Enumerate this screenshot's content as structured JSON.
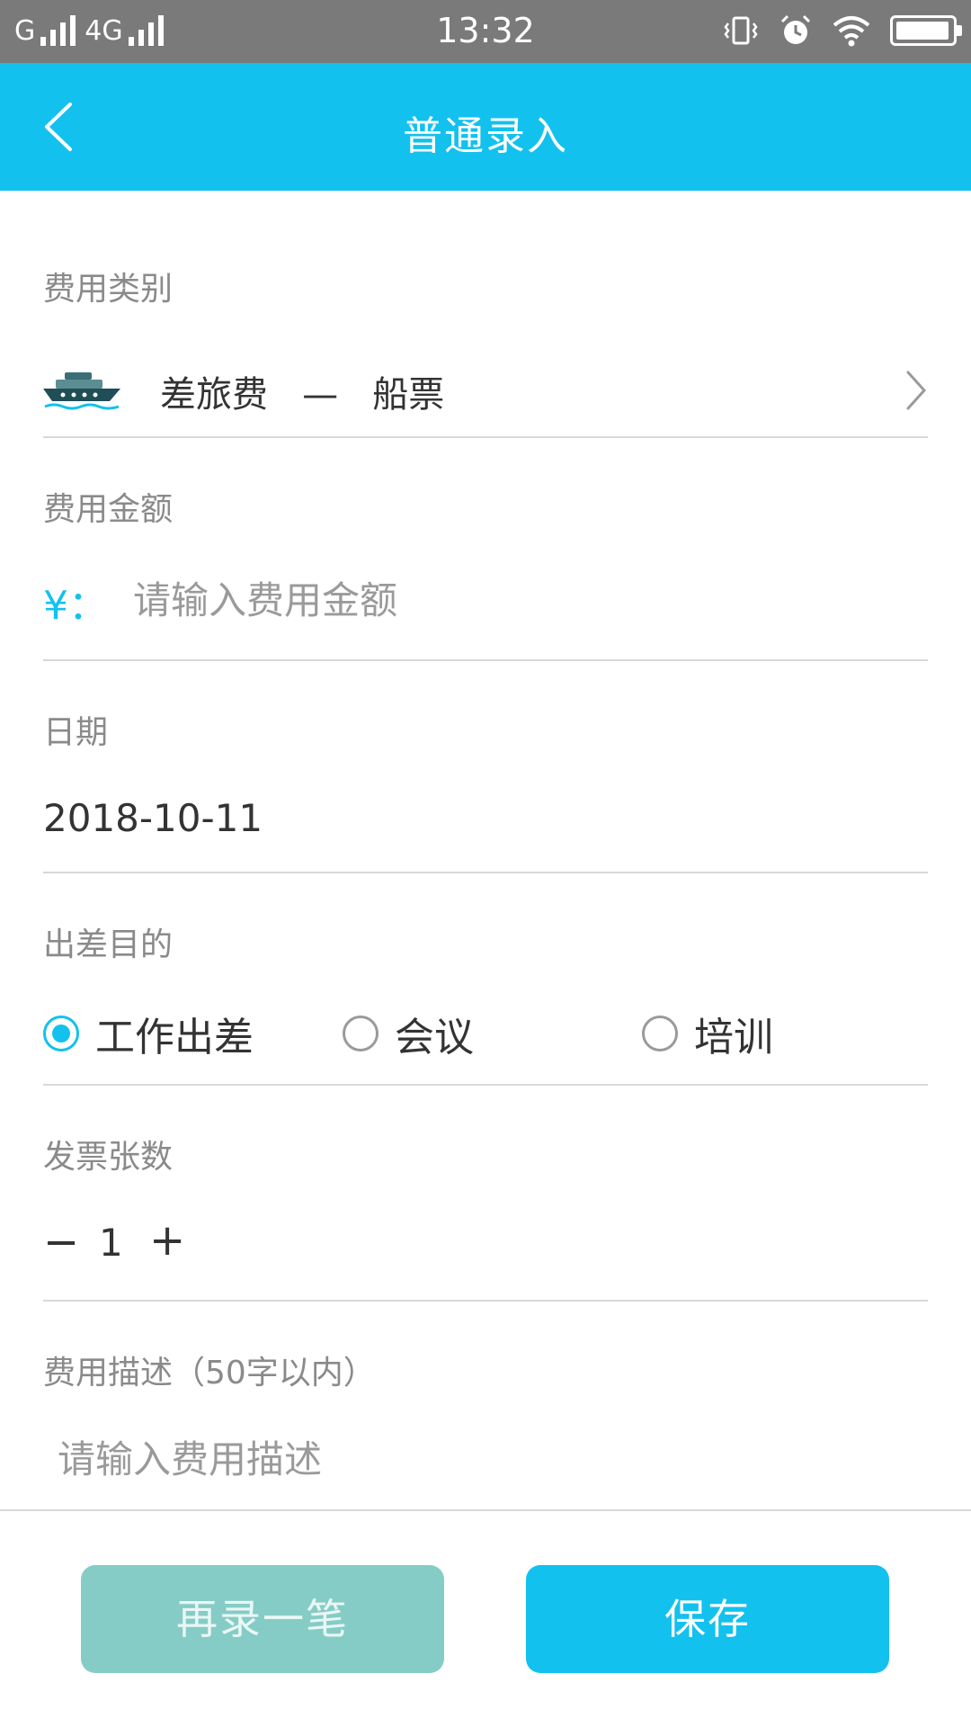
{
  "status_bar": {
    "carrier1": "G",
    "carrier2": "4G",
    "time": "13:32"
  },
  "header": {
    "title": "普通录入"
  },
  "form": {
    "category": {
      "label": "费用类别",
      "value": "差旅费   —   船票",
      "icon": "ship-icon"
    },
    "amount": {
      "label": "费用金额",
      "prefix": "¥：",
      "placeholder": "请输入费用金额"
    },
    "date": {
      "label": "日期",
      "value": "2018-10-11"
    },
    "purpose": {
      "label": "出差目的",
      "options": [
        "工作出差",
        "会议",
        "培训"
      ],
      "selected": "工作出差"
    },
    "invoice_count": {
      "label": "发票张数",
      "minus": "−",
      "value": "1",
      "plus": "+"
    },
    "description": {
      "label": "费用描述（50字以内）",
      "placeholder": "请输入费用描述"
    }
  },
  "buttons": {
    "again_label": "再录一笔",
    "save_label": "保存"
  },
  "colors": {
    "accent": "#12c1ee",
    "secondary_button": "#86ccc6",
    "status_bar": "#7a7a7a"
  }
}
